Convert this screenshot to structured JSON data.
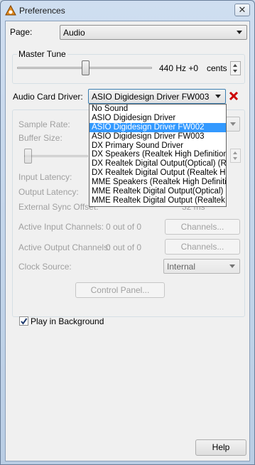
{
  "window": {
    "title": "Preferences",
    "close_glyph": "✕"
  },
  "page": {
    "label": "Page:",
    "value": "Audio"
  },
  "master_tune": {
    "label": "Master Tune",
    "value": "440 Hz +0",
    "unit": "cents",
    "level": 0.5
  },
  "audio_card": {
    "label": "Audio Card Driver:",
    "value": "ASIO Digidesign Driver FW003",
    "remove_color": "#cc0000"
  },
  "driver_options": [
    "No Sound",
    "ASIO Digidesign Driver",
    "ASIO Digidesign Driver FW002",
    "ASIO Digidesign Driver FW003",
    "DX Primary Sound Driver",
    "DX Speakers (Realtek High Definition Au",
    "DX Realtek Digital Output(Optical) (Realt",
    "DX Realtek Digital Output (Realtek High D",
    "MME Speakers (Realtek High Definiti",
    "MME Realtek Digital Output(Optical)",
    "MME Realtek Digital Output (Realtek"
  ],
  "driver_highlighted_index": 2,
  "settings": {
    "sample_rate": "Sample Rate:",
    "buffer_size": "Buffer Size:",
    "input_latency": "Input Latency:",
    "output_latency": "Output Latency:",
    "external_sync_offset": "External Sync Offset:",
    "external_sync_value": "32 ms",
    "active_input": "Active Input Channels:",
    "active_input_value": "0 out of 0",
    "active_output": "Active Output Channels:",
    "active_output_value": "0 out of 0",
    "channels_button": "Channels...",
    "clock_source": "Clock Source:",
    "clock_source_value": "Internal",
    "control_panel": "Control Panel..."
  },
  "play_in_background": {
    "label": "Play in Background",
    "checked": true
  },
  "help_button": "Help"
}
